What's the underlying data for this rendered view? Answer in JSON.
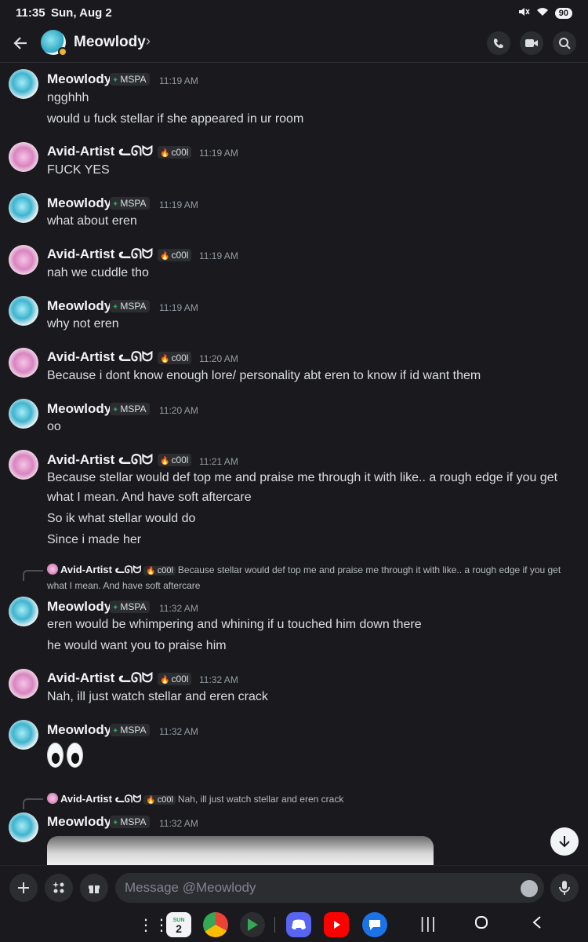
{
  "status": {
    "time": "11:35",
    "date": "Sun, Aug 2",
    "battery": "90"
  },
  "header": {
    "name": "Meowlody",
    "chevron": "›"
  },
  "messages": [
    {
      "author": "Meowlody",
      "tag": "MSPA",
      "time": "11:19 AM",
      "lines": [
        "ngghhh",
        "would u fuck stellar if she appeared in ur room"
      ]
    },
    {
      "author": "Avid-Artist ᓚᘏᗢ",
      "tag": "c00l",
      "time": "11:19 AM",
      "lines": [
        "FUCK YES"
      ]
    },
    {
      "author": "Meowlody",
      "tag": "MSPA",
      "time": "11:19 AM",
      "lines": [
        "what about eren"
      ]
    },
    {
      "author": "Avid-Artist ᓚᘏᗢ",
      "tag": "c00l",
      "time": "11:19 AM",
      "lines": [
        "nah we cuddle tho"
      ]
    },
    {
      "author": "Meowlody",
      "tag": "MSPA",
      "time": "11:19 AM",
      "lines": [
        "why not eren"
      ]
    },
    {
      "author": "Avid-Artist ᓚᘏᗢ",
      "tag": "c00l",
      "time": "11:20 AM",
      "lines": [
        "Because i dont know enough lore/ personality abt eren to know if id want them"
      ]
    },
    {
      "author": "Meowlody",
      "tag": "MSPA",
      "time": "11:20 AM",
      "lines": [
        "oo"
      ]
    },
    {
      "author": "Avid-Artist ᓚᘏᗢ",
      "tag": "c00l",
      "time": "11:21 AM",
      "lines": [
        "Because stellar would def top me and praise me through it with like.. a rough edge if you get",
        "what I mean. And have soft aftercare",
        "So ik what stellar would do",
        "Since i made her"
      ]
    },
    {
      "author": "Meowlody",
      "tag": "MSPA",
      "time": "11:32 AM",
      "lines": [
        "eren would be whimpering and whining if u touched him down there",
        "he would want you to praise him"
      ]
    },
    {
      "author": "Avid-Artist ᓚᘏᗢ",
      "tag": "c00l",
      "time": "11:32 AM",
      "lines": [
        "Nah, ill just watch stellar and eren crack"
      ]
    },
    {
      "author": "Meowlody",
      "tag": "MSPA",
      "time": "11:32 AM",
      "lines": []
    },
    {
      "author": "Meowlody",
      "tag": "MSPA",
      "time": "11:32 AM",
      "lines": []
    }
  ],
  "replies": [
    {
      "author": "Avid-Artist ᓚᘏᗢ",
      "tag": "c00l",
      "text1": "Because stellar would def top me and praise me through it with like.. a rough edge if you get",
      "text2": "what I mean. And have soft aftercare"
    },
    {
      "author": "Avid-Artist ᓚᘏᗢ",
      "tag": "c00l",
      "text1": "Nah, ill just watch stellar and eren crack",
      "text2": ""
    }
  ],
  "composer": {
    "placeholder": "Message @Meowlody"
  },
  "nav": {
    "calendar_day": "SUN",
    "calendar_date": "2"
  },
  "icons": {
    "back": "arrow-left",
    "call": "phone",
    "video": "video-camera",
    "search": "magnifier",
    "plus": "plus",
    "apps": "sparkle-grid",
    "gift": "gift",
    "emoji": "smiley",
    "mic": "microphone"
  },
  "colors": {
    "background": "#1a1a1e",
    "mspa": "#23a55a",
    "cool": "#ed4245",
    "idle": "#f0b232"
  }
}
